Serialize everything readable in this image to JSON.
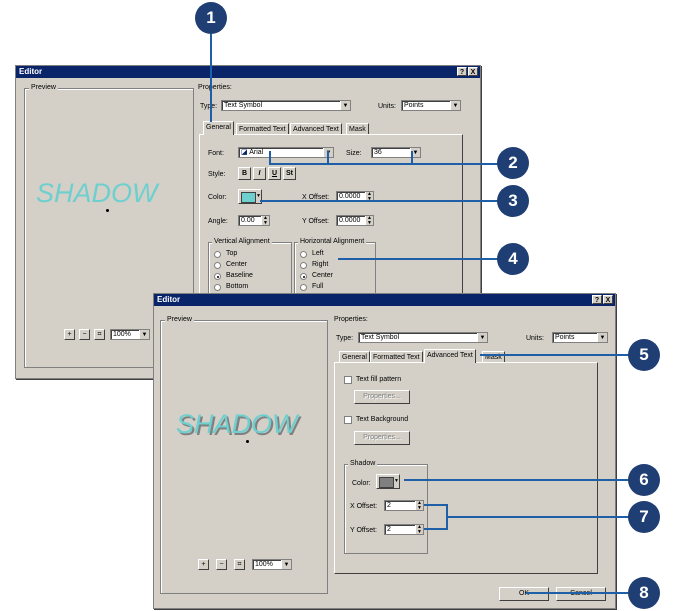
{
  "dialog1": {
    "title": "Editor",
    "help_btn": "?",
    "close_btn": "X",
    "preview_label": "Preview",
    "preview_text": "SHADOW",
    "zoom_in": "+",
    "zoom_out": "−",
    "fit": "⌗",
    "zoom_value": "100%",
    "properties_label": "Properties:",
    "type_label": "Type:",
    "type_value": "Text Symbol",
    "units_label": "Units:",
    "units_value": "Points",
    "tabs": [
      "General",
      "Formatted Text",
      "Advanced Text",
      "Mask"
    ],
    "font_label": "Font:",
    "font_value": "Arial",
    "size_label": "Size:",
    "size_value": "36",
    "style_label": "Style:",
    "style_buttons": [
      "B",
      "I",
      "U",
      "St"
    ],
    "color_label": "Color:",
    "color_swatch": "#6ecfcf",
    "xoffset_label": "X Offset:",
    "xoffset_value": "0.0000",
    "angle_label": "Angle:",
    "angle_value": "0.00",
    "yoffset_label": "Y Offset:",
    "yoffset_value": "0.0000",
    "valign_label": "Vertical Alignment",
    "valign_options": [
      "Top",
      "Center",
      "Baseline",
      "Bottom"
    ],
    "halign_label": "Horizontal Alignment",
    "halign_options": [
      "Left",
      "Right",
      "Center",
      "Full"
    ]
  },
  "dialog2": {
    "title": "Editor",
    "help_btn": "?",
    "close_btn": "X",
    "preview_label": "Preview",
    "preview_text": "SHADOW",
    "zoom_in": "+",
    "zoom_out": "−",
    "fit": "⌗",
    "zoom_value": "100%",
    "properties_label": "Properties:",
    "type_label": "Type:",
    "type_value": "Text Symbol",
    "units_label": "Units:",
    "units_value": "Points",
    "tabs": [
      "General",
      "Formatted Text",
      "Advanced Text",
      "Mask"
    ],
    "text_fill_pattern": "Text fill pattern",
    "properties_btn": "Properties...",
    "text_background": "Text Background",
    "shadow_group": "Shadow",
    "shadow_color_label": "Color:",
    "shadow_color": "#808080",
    "xoffset_label": "X Offset:",
    "xoffset_value": "2",
    "yoffset_label": "Y Offset:",
    "yoffset_value": "2",
    "ok": "OK",
    "cancel": "Cancel"
  },
  "callouts": [
    "1",
    "2",
    "3",
    "4",
    "5",
    "6",
    "7",
    "8"
  ],
  "colors": {
    "callout": "#1f3e73",
    "leader": "#1f5fa8",
    "titlebar": "#0a246a",
    "dialog": "#d4d0c8"
  }
}
